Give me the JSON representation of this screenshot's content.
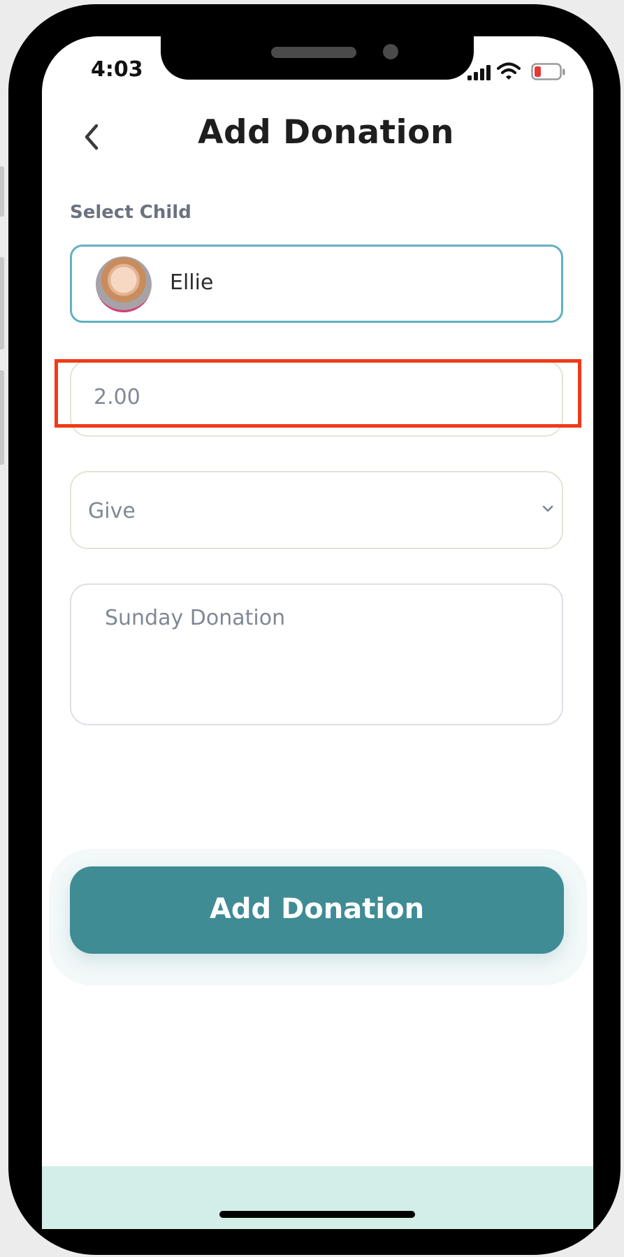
{
  "status_bar": {
    "time": "4:03",
    "icons": [
      "signal-icon",
      "wifi-icon",
      "battery-icon"
    ],
    "battery_color": "#e53935"
  },
  "header": {
    "title": "Add Donation",
    "back_icon": "chevron-left-icon"
  },
  "form": {
    "select_child_label": "Select Child",
    "selected_child": {
      "name": "Ellie",
      "avatar": "child-avatar"
    },
    "amount": {
      "value": "2.00"
    },
    "donation_type": {
      "selected": "Give",
      "icon": "chevron-down-icon"
    },
    "note": {
      "value": "Sunday Donation"
    }
  },
  "submit": {
    "label": "Add Donation"
  },
  "colors": {
    "accent": "#3f8c95",
    "selected_border": "#62b1bd",
    "highlight": "#f03a17",
    "bottom_bar": "#d3eee9"
  }
}
